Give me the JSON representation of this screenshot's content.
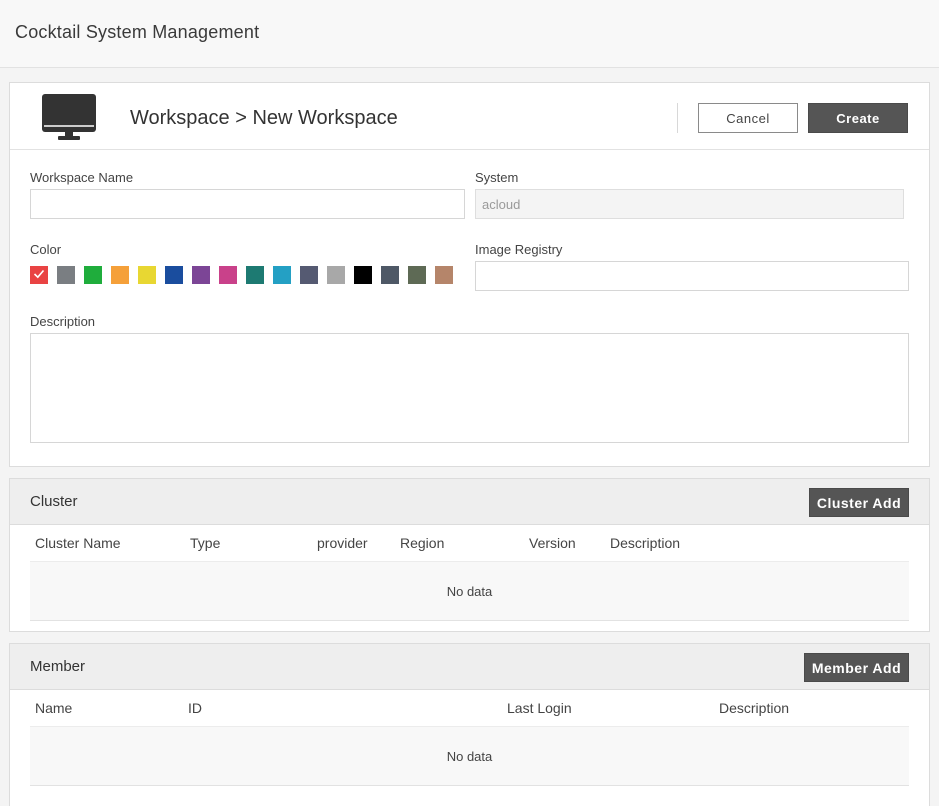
{
  "app": {
    "title": "Cocktail System Management"
  },
  "workspace": {
    "breadcrumb": "Workspace > New Workspace",
    "cancel_label": "Cancel",
    "create_label": "Create",
    "name_label": "Workspace Name",
    "name_value": "",
    "system_label": "System",
    "system_value": "acloud",
    "color_label": "Color",
    "colors": [
      "#e94343",
      "#7a7e82",
      "#1fad3c",
      "#f5a03a",
      "#e8d732",
      "#1a4d9e",
      "#7c4596",
      "#c9418a",
      "#1d7a72",
      "#24a0c4",
      "#555a72",
      "#a8a8a8",
      "#000000",
      "#4e5866",
      "#5e6a55",
      "#b5856a"
    ],
    "selected_color_index": 0,
    "registry_label": "Image Registry",
    "registry_value": "",
    "description_label": "Description",
    "description_value": ""
  },
  "cluster": {
    "title": "Cluster",
    "add_label": "Cluster Add",
    "columns": [
      "Cluster Name",
      "Type",
      "provider",
      "Region",
      "Version",
      "Description"
    ],
    "empty_text": "No data"
  },
  "member": {
    "title": "Member",
    "add_label": "Member Add",
    "columns": [
      "Name",
      "ID",
      "Last Login",
      "Description"
    ],
    "empty_text": "No data"
  }
}
